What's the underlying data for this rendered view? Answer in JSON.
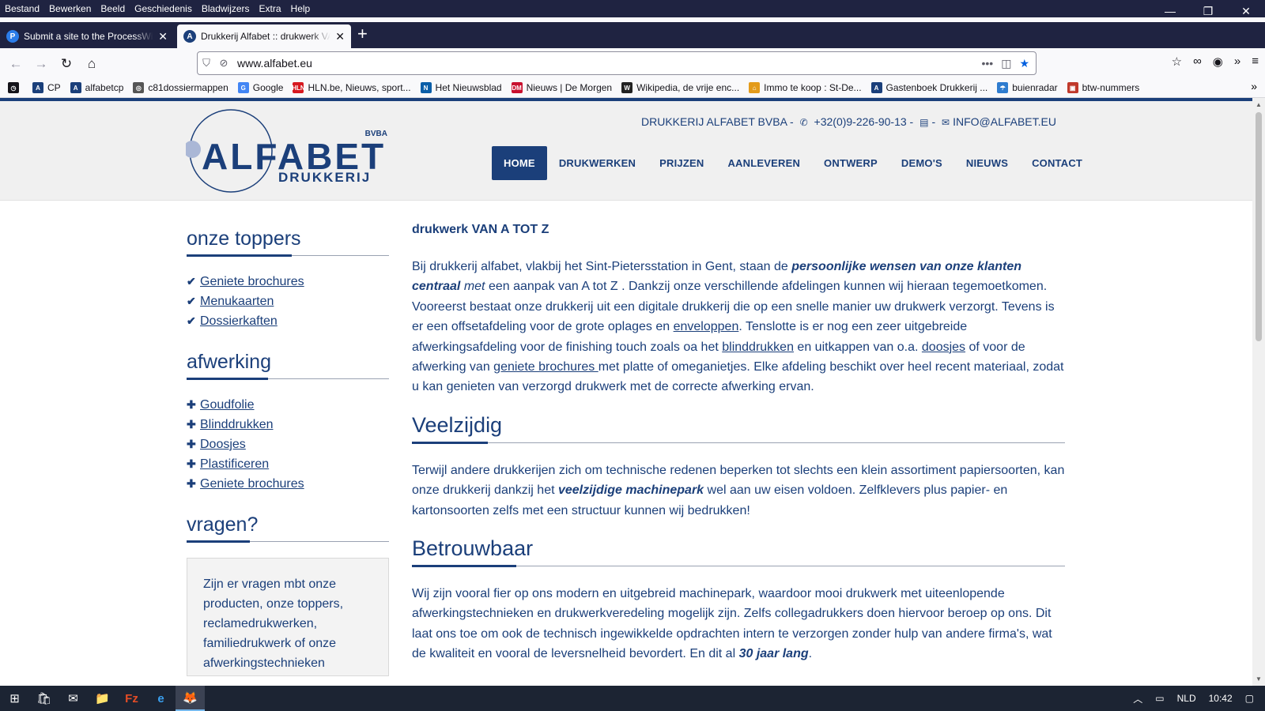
{
  "menubar": {
    "items": [
      "Bestand",
      "Bewerken",
      "Beeld",
      "Geschiedenis",
      "Bladwijzers",
      "Extra",
      "Help"
    ]
  },
  "window_controls": {
    "minimize": "—",
    "restore": "❐",
    "close": "✕"
  },
  "tabs": [
    {
      "title": "Submit a site to the ProcessWire",
      "favicon": "P"
    },
    {
      "title": "Drukkerij Alfabet :: drukwerk VAN",
      "favicon": "A"
    }
  ],
  "newtab_label": "+",
  "navbar": {
    "url": "www.alfabet.eu",
    "icons": {
      "back": "←",
      "forward": "→",
      "reload": "↻",
      "home": "⌂",
      "shield": "⛉",
      "tracking": "⊘",
      "more": "•••",
      "pocket": "◫",
      "star": "★"
    },
    "right_icons": [
      "☆",
      "∞",
      "◉",
      "»",
      "≡"
    ]
  },
  "bookmarks": [
    {
      "label": "",
      "icon": "◷",
      "color": "#15141a"
    },
    {
      "label": "CP",
      "icon": "A",
      "color": "#1b3f7a"
    },
    {
      "label": "alfabetcp",
      "icon": "A",
      "color": "#1b3f7a"
    },
    {
      "label": "c81dossiermappen",
      "icon": "◎",
      "color": "#555555"
    },
    {
      "label": "Google",
      "icon": "G",
      "color": "#4285f4"
    },
    {
      "label": "HLN.be, Nieuws, sport...",
      "icon": "HLN",
      "color": "#d71920"
    },
    {
      "label": "Het Nieuwsblad",
      "icon": "N",
      "color": "#0b5ea8"
    },
    {
      "label": "Nieuws | De Morgen",
      "icon": "DM",
      "color": "#c8102e"
    },
    {
      "label": "Wikipedia, de vrije enc...",
      "icon": "W",
      "color": "#222222"
    },
    {
      "label": "Immo te koop : St-De...",
      "icon": "⌂",
      "color": "#e39b1b"
    },
    {
      "label": "Gastenboek Drukkerij ...",
      "icon": "A",
      "color": "#1b3f7a"
    },
    {
      "label": "buienradar",
      "icon": "☂",
      "color": "#2f7ccf"
    },
    {
      "label": "btw-nummers",
      "icon": "▣",
      "color": "#c0392b"
    }
  ],
  "bookmarks_more": "»",
  "site": {
    "logo": {
      "name": "ALFABET",
      "sub": "DRUKKERIJ",
      "badge": "BVBA"
    },
    "contact": {
      "company": "DRUKKERIJ ALFABET BVBA -",
      "phone": "+32(0)9-226-90-13 -",
      "email": "INFO@ALFABET.EU",
      "phone_icon": "✆",
      "fax_icon": "▤",
      "mail_icon": "✉"
    },
    "nav": [
      "HOME",
      "DRUKWERKEN",
      "PRIJZEN",
      "AANLEVEREN",
      "ONTWERP",
      "DEMO'S",
      "NIEUWS",
      "CONTACT"
    ],
    "sidebar": {
      "toppers_title": "onze toppers",
      "toppers": [
        "Geniete brochures",
        "Menukaarten",
        "Dossierkaften"
      ],
      "afwerking_title": "afwerking",
      "afwerking": [
        "Goudfolie",
        "Blinddrukken",
        "Doosjes",
        "Plastificeren",
        "Geniete brochures"
      ],
      "vragen_title": "vragen?",
      "vragen_text": "Zijn er vragen mbt onze producten, onze toppers, reclamedrukwerken, familiedrukwerk of onze afwerkingstechnieken"
    },
    "content": {
      "lead": "drukwerk VAN A TOT Z",
      "intro": {
        "t1": "Bij drukkerij alfabet, vlakbij het Sint-Pietersstation in Gent, staan de ",
        "b1": "persoonlijke wensen van onze klanten centraal",
        "i1": " met",
        "t2": " een aanpak van A tot Z . Dankzij onze verschillende afdelingen kunnen wij hieraan tegemoetkomen. Vooreerst bestaat onze drukkerij uit een digitale drukkerij die op een snelle manier uw drukwerk verzorgt. Tevens is er een offsetafdeling voor de grote oplages en ",
        "l1": "enveloppen",
        "t3": ". Tenslotte is er nog een zeer uitgebreide afwerkingsafdeling voor de finishing touch zoals oa het ",
        "l2": "blinddrukken",
        "t4": " en uitkappen van o.a. ",
        "l3": "doosjes",
        "t5": " of voor de afwerking van ",
        "l4": "geniete brochures ",
        "t6": "met platte of omeganietjes. Elke afdeling beschikt over heel recent materiaal, zodat u kan genieten van verzorgd drukwerk met de correcte afwerking ervan."
      },
      "veelzijdig_title": "Veelzijdig",
      "veelzijdig": {
        "t1": "Terwijl andere drukkerijen zich om technische redenen beperken tot slechts een klein assortiment papiersoorten, kan onze drukkerij dankzij het ",
        "b1": "veelzijdige machinepark",
        "t2": " wel aan uw eisen voldoen. Zelfklevers plus papier- en kartonsoorten zelfs met een structuur kunnen wij bedrukken!"
      },
      "betrouwbaar_title": "Betrouwbaar",
      "betrouwbaar": {
        "t1": "Wij zijn vooral fier op ons modern en uitgebreid machinepark, waardoor mooi drukwerk met uiteenlopende afwerkingstechnieken en drukwerkveredeling mogelijk zijn. Zelfs collegadrukkers doen hiervoor beroep op ons. Dit laat ons toe om ook de technisch ingewikkelde opdrachten intern te verzorgen zonder hulp van andere firma's, wat de kwaliteit en vooral de leversnelheid bevordert. En dit al ",
        "b1": "30 jaar lang",
        "t2": "."
      }
    }
  },
  "taskbar": {
    "apps": [
      "⊞",
      "🛍",
      "✉",
      "📁",
      "Fz",
      "e",
      "🦊"
    ],
    "tray": {
      "chevron": "︿",
      "battery": "▭",
      "lang": "NLD",
      "time": "10:42",
      "notif": "▢"
    }
  },
  "colors": {
    "brand": "#1b3f7a",
    "chrome_dark": "#1f2341",
    "taskbar": "#1c2433"
  }
}
